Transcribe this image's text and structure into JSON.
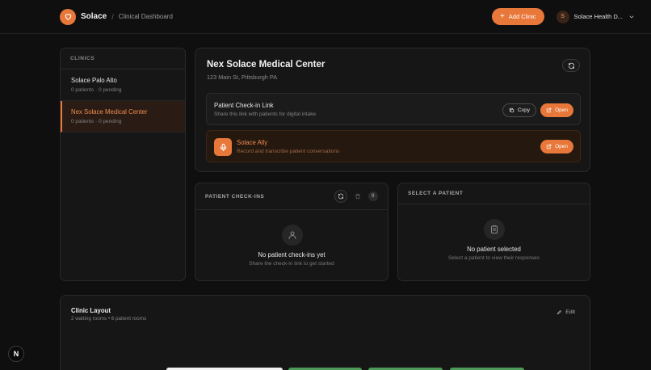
{
  "header": {
    "brand": "Solace",
    "separator": "/",
    "crumb": "Clinical Dashboard",
    "add_clinic_label": "Add Clinic",
    "account_initial": "S",
    "account_name": "Solace Health D..."
  },
  "sidebar": {
    "heading": "CLINICS",
    "items": [
      {
        "name": "Solace Palo Alto",
        "meta": "0 patients · 0 pending",
        "active": false
      },
      {
        "name": "Nex Solace Medical Center",
        "meta": "0 patients · 0 pending",
        "active": true
      }
    ]
  },
  "clinic": {
    "title": "Nex Solace Medical Center",
    "address": "123 Main St, Pittsburgh PA",
    "checkin": {
      "title": "Patient Check-in Link",
      "subtitle": "Share this link with patients for digital intake",
      "copy_label": "Copy",
      "open_label": "Open"
    },
    "ally": {
      "title": "Solace Ally",
      "subtitle": "Record and transcribe patient conversations",
      "open_label": "Open"
    }
  },
  "checkins": {
    "heading": "PATIENT CHECK-INS",
    "count": "0",
    "empty_title": "No patient check-ins yet",
    "empty_sub": "Share the check-in link to get started"
  },
  "select_patient": {
    "heading": "SELECT A PATIENT",
    "empty_title": "No patient selected",
    "empty_sub": "Select a patient to view their responses"
  },
  "layout": {
    "title": "Clinic Layout",
    "subtitle": "2 waiting rooms • 6 patient rooms",
    "edit_label": "Edit"
  },
  "badge": {
    "letter": "N"
  },
  "colors": {
    "accent": "#e8773a",
    "background": "#0f0f0f",
    "card": "#161616",
    "room_green": "#4e9a58"
  }
}
